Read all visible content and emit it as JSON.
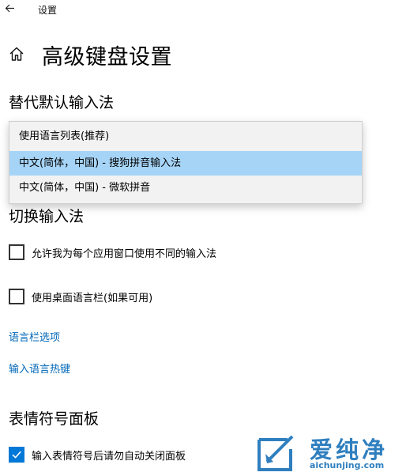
{
  "titlebar": {
    "title": "设置"
  },
  "header": {
    "title": "高级键盘设置"
  },
  "override": {
    "section_title": "替代默认输入法",
    "dropdown_options": [
      "使用语言列表(推荐)",
      "中文(简体，中国) - 搜狗拼音输入法",
      "中文(简体，中国) - 微软拼音"
    ],
    "selected_index": 1
  },
  "switching": {
    "section_title": "切换输入法",
    "checkboxes": [
      {
        "label": "允许我为每个应用窗口使用不同的输入法",
        "checked": false
      },
      {
        "label": "使用桌面语言栏(如果可用)",
        "checked": false
      }
    ],
    "links": [
      "语言栏选项",
      "输入语言热键"
    ]
  },
  "emoji": {
    "section_title": "表情符号面板",
    "checkbox": {
      "label": "输入表情符号后请勿自动关闭面板",
      "checked": true
    }
  },
  "watermark": {
    "brand": "爱纯净",
    "url": "aichunjing.com"
  },
  "colors": {
    "accent": "#0078d7",
    "link": "#0067b8",
    "selected_item": "#a6d4f7",
    "watermark": "#2f7fbf"
  },
  "icons": {
    "back": "arrow-left",
    "home": "home",
    "check": "checkmark"
  }
}
